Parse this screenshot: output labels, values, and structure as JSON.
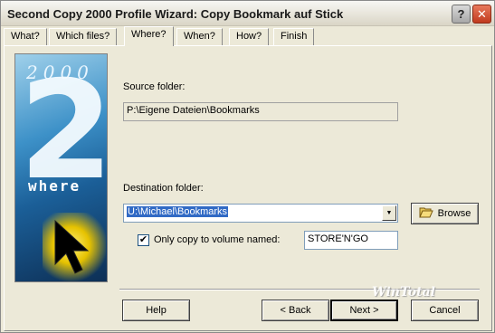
{
  "window": {
    "title": "Second Copy 2000 Profile Wizard: Copy Bookmark auf Stick",
    "help_button": "?",
    "close_button": "✕"
  },
  "tabs": [
    {
      "label": "What?",
      "active": false
    },
    {
      "label": "Which files?",
      "active": false
    },
    {
      "label": "Where?",
      "active": true
    },
    {
      "label": "When?",
      "active": false
    },
    {
      "label": "How?",
      "active": false
    },
    {
      "label": "Finish",
      "active": false
    }
  ],
  "art": {
    "year": "2000",
    "digit": "2",
    "word": "where"
  },
  "source": {
    "label": "Source folder:",
    "value": "P:\\Eigene Dateien\\Bookmarks"
  },
  "destination": {
    "label": "Destination folder:",
    "value": "U:\\Michael\\Bookmarks",
    "browse_label": "Browse"
  },
  "volume": {
    "checked": true,
    "label": "Only copy to volume named:",
    "value": "STORE'N'GO"
  },
  "buttons": {
    "help": "Help",
    "back": "< Back",
    "next": "Next >",
    "cancel": "Cancel"
  },
  "watermark": "WinTotal",
  "icons": {
    "browse": "folder-open-icon",
    "dropdown": "chevron-down-icon",
    "check": "checkmark-icon"
  }
}
